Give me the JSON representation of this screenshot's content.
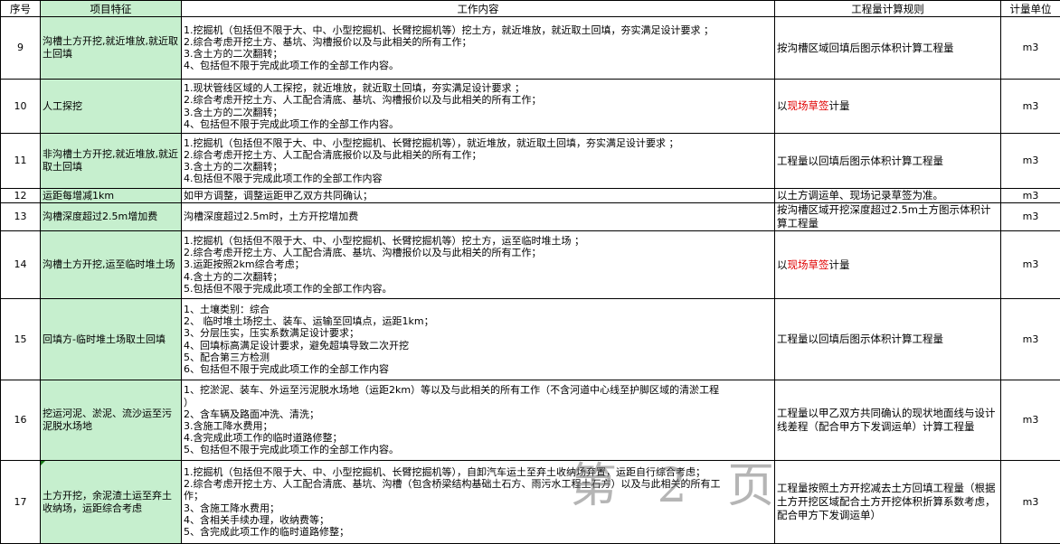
{
  "headers": {
    "no": "序号",
    "feature": "项目特征",
    "work": "工作内容",
    "rule": "工程量计算规则",
    "unit": "计量单位"
  },
  "rows": [
    {
      "no": "9",
      "feature": "沟槽土方开挖,就近堆放,就近取土回填",
      "work": [
        "1.挖掘机（包括但不限于大、中、小型挖掘机、长臂挖掘机等）挖土方，就近堆放，就近取土回填，夯实满足设计要求 ；",
        "2.综合考虑开挖土方、基坑、沟槽报价以及与此相关的所有工作；",
        "3.含土方的二次翻转；",
        "4、包括但不限于完成此项工作的全部工作内容。"
      ],
      "rule_pre": "按沟槽区域回填后图示体积计算工程量",
      "rule_red": "",
      "rule_post": "",
      "unit": "m3"
    },
    {
      "no": "10",
      "feature": "人工探挖",
      "work": [
        "1.现状管线区域的人工探挖，就近堆放，就近取土回填，夯实满足设计要求 ；",
        "2.综合考虑开挖土方、人工配合清底、基坑、沟槽报价以及与此相关的所有工作；",
        "3.含土方的二次翻转；",
        "4、包括但不限于完成此项工作的全部工作内容。"
      ],
      "rule_pre": "以",
      "rule_red": "现场草签",
      "rule_post": "计量",
      "unit": "m3"
    },
    {
      "no": "11",
      "feature": "非沟槽土方开挖,就近堆放,就近取土回填",
      "work": [
        "1.挖掘机（包括但不限于大、中、小型挖掘机、长臂挖掘机等），就近堆放，就近取土回填，夯实满足设计要求 ；",
        "2.综合考虑开挖土方、人工配合清底报价以及与此相关的所有工作；",
        "3.含土方的二次翻转；",
        "4.包括但不限于完成此项工作的全部工作内容"
      ],
      "rule_pre": "工程量以回填后图示体积计算工程量",
      "rule_red": "",
      "rule_post": "",
      "unit": "m3"
    },
    {
      "no": "12",
      "feature": "运距每增减1km",
      "work": [
        "如甲方调整，调整运距甲乙双方共同确认；"
      ],
      "rule_pre": "以土方调运单、现场记录草签为准。",
      "rule_red": "",
      "rule_post": "",
      "unit": "m3"
    },
    {
      "no": "13",
      "feature": "沟槽深度超过2.5m增加费",
      "work": [
        "沟槽深度超过2.5m时，土方开挖增加费"
      ],
      "rule_pre": "按沟槽区域开挖深度超过2.5m土方图示体积计算工程量",
      "rule_red": "",
      "rule_post": "",
      "unit": "m3"
    },
    {
      "no": "14",
      "feature": "沟槽土方开挖,运至临时堆土场",
      "work": [
        "1.挖掘机（包括但不限于大、中、小型挖掘机、长臂挖掘机等）挖土方，运至临时堆土场 ；",
        "2.综合考虑开挖土方、人工配合清底、基坑、沟槽报价以及与此相关的所有工作；",
        "3.运距按照2km综合考虑；",
        "4.含土方的二次翻转；",
        "5.包括但不限于完成此项工作的全部工作内容。"
      ],
      "rule_pre": "以",
      "rule_red": "现场草签",
      "rule_post": "计量",
      "unit": "m3"
    },
    {
      "no": "15",
      "feature": "回填方-临时堆土场取土回填",
      "work": [
        "1、土壤类别：综合",
        "2、 临时堆土场挖土、装车、运输至回填点，运距1km；",
        "3、分层压实，压实系数满足设计要求；",
        "4、回填标高满足设计要求，避免超填导致二次开挖",
        "5、配合第三方检测",
        "6、包括但不限于完成此项工作的全部工作内容"
      ],
      "rule_pre": "工程量以回填后图示体积计算工程量",
      "rule_red": "",
      "rule_post": "",
      "unit": "m3"
    },
    {
      "no": "16",
      "feature": "挖运河泥、淤泥、流沙运至污泥脱水场地",
      "work": [
        "1、挖淤泥、装车、外运至污泥脱水场地（运距2km）等以及与此相关的所有工作（不含河道中心线至护脚区域的清淤工程",
        "）",
        "2、含车辆及路面冲洗、清洗；",
        "3.含施工降水费用；",
        "4.含完成此项工作的临时道路修整；",
        "5、包括但不限于完成此项工作的全部工作内容。"
      ],
      "rule_pre": "工程量以甲乙双方共同确认的现状地面线与设计线差程（配合甲方下发调运单）计算工程量",
      "rule_red": "",
      "rule_post": "",
      "unit": "m3"
    },
    {
      "no": "17",
      "feature": "土方开挖，余泥渣土运至弃土收纳场，运距综合考虑",
      "work": [
        "1.挖掘机（包括但不限于大、中、小型挖掘机、长臂挖掘机等），自卸汽车运土至弃土收纳场弃置，运距自行综合考虑；",
        "2.综合考虑开挖土方、人工配合清底、基坑、沟槽（包含桥梁结构基础土石方、雨污水工程土石方）以及与此相关的所有工",
        "作；",
        "3、含施工降水费用；",
        "4、含相关手续办理，收纳费等；",
        "5、含完成此项工作的临时道路修整；"
      ],
      "rule_pre": "工程量按照土方开挖减去土方回填工程量（根据土方开挖区域配合土方开挖体积折算系数考虑，配合甲方下发调运单）",
      "rule_red": "",
      "rule_post": "",
      "unit": "m3"
    }
  ],
  "watermark": "第 2 页"
}
